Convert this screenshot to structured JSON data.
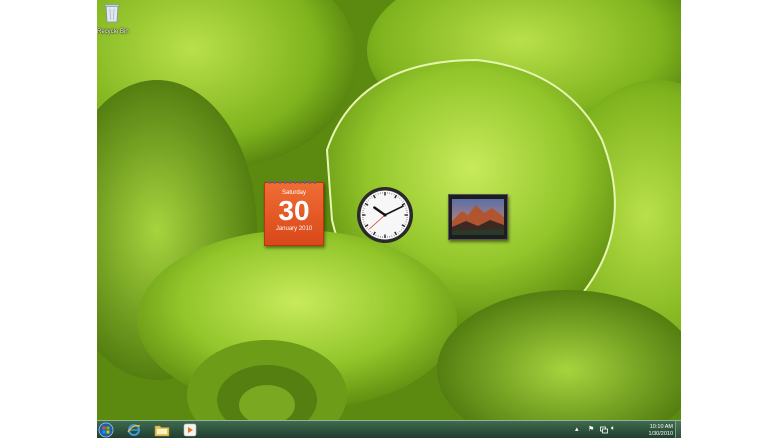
{
  "desktop": {
    "icons": [
      {
        "label": "Recycle Bin",
        "icon": "recycle-bin-icon"
      }
    ]
  },
  "gadgets": {
    "calendar": {
      "day_name": "Saturday",
      "day_number": "30",
      "month_year": "January 2010"
    },
    "clock": {
      "hour": 10,
      "minute": 10,
      "second": 38
    },
    "slideshow": {
      "icon": "landscape-photo"
    }
  },
  "taskbar": {
    "start": {
      "icon": "windows-orb-icon"
    },
    "pinned": [
      {
        "name": "Internet Explorer",
        "icon": "internet-explorer-icon"
      },
      {
        "name": "Windows Explorer",
        "icon": "folder-icon"
      },
      {
        "name": "Windows Media Player",
        "icon": "media-player-icon"
      }
    ],
    "tray": {
      "icons": [
        "show-hidden-icons-chevron",
        "action-center-flag-icon",
        "network-icon",
        "volume-icon"
      ],
      "time": "10:10 AM",
      "date": "1/30/2010"
    }
  },
  "colors": {
    "wallpaper_green": "#8cc22a",
    "calendar_orange": "#e55a24",
    "taskbar": "#2d5540"
  }
}
